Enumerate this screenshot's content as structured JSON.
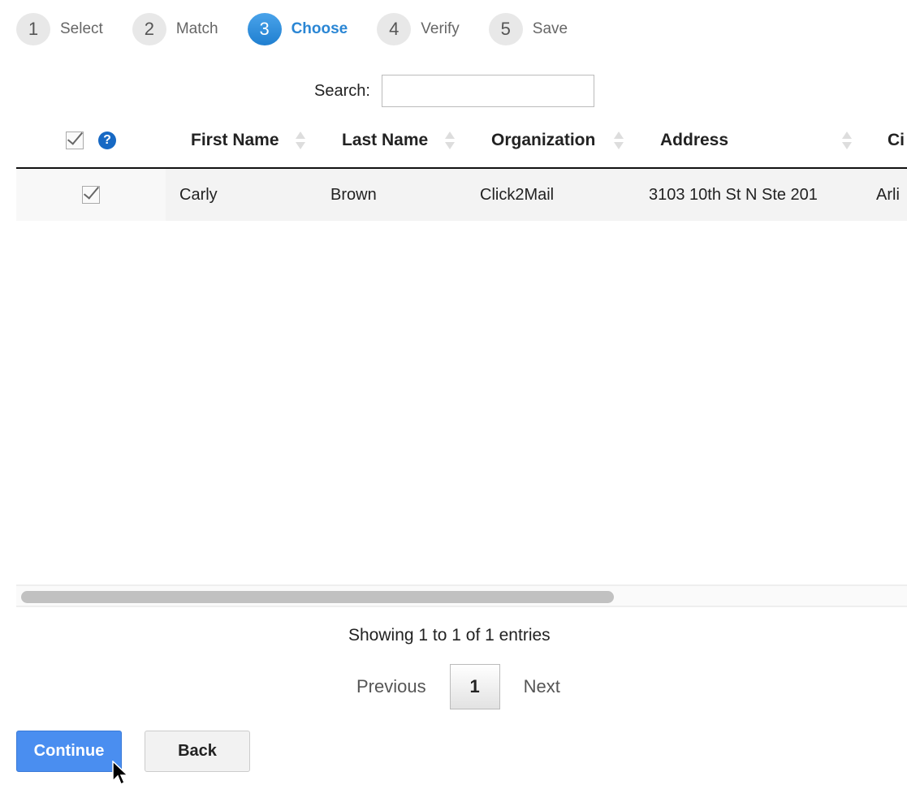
{
  "steps": [
    {
      "num": "1",
      "label": "Select",
      "active": false
    },
    {
      "num": "2",
      "label": "Match",
      "active": false
    },
    {
      "num": "3",
      "label": "Choose",
      "active": true
    },
    {
      "num": "4",
      "label": "Verify",
      "active": false
    },
    {
      "num": "5",
      "label": "Save",
      "active": false
    }
  ],
  "search": {
    "label": "Search:",
    "value": "",
    "placeholder": ""
  },
  "table": {
    "help_icon": "?",
    "columns": [
      "First Name",
      "Last Name",
      "Organization",
      "Address",
      "Ci"
    ],
    "rows": [
      {
        "checked": true,
        "cells": [
          "Carly",
          "Brown",
          "Click2Mail",
          "3103 10th St N Ste 201",
          "Arli"
        ]
      }
    ]
  },
  "info": "Showing 1 to 1 of 1 entries",
  "pager": {
    "previous": "Previous",
    "current": "1",
    "next": "Next"
  },
  "buttons": {
    "continue": "Continue",
    "back": "Back"
  },
  "colors": {
    "accent": "#2a86d4",
    "primary_button": "#4a8ef0"
  }
}
